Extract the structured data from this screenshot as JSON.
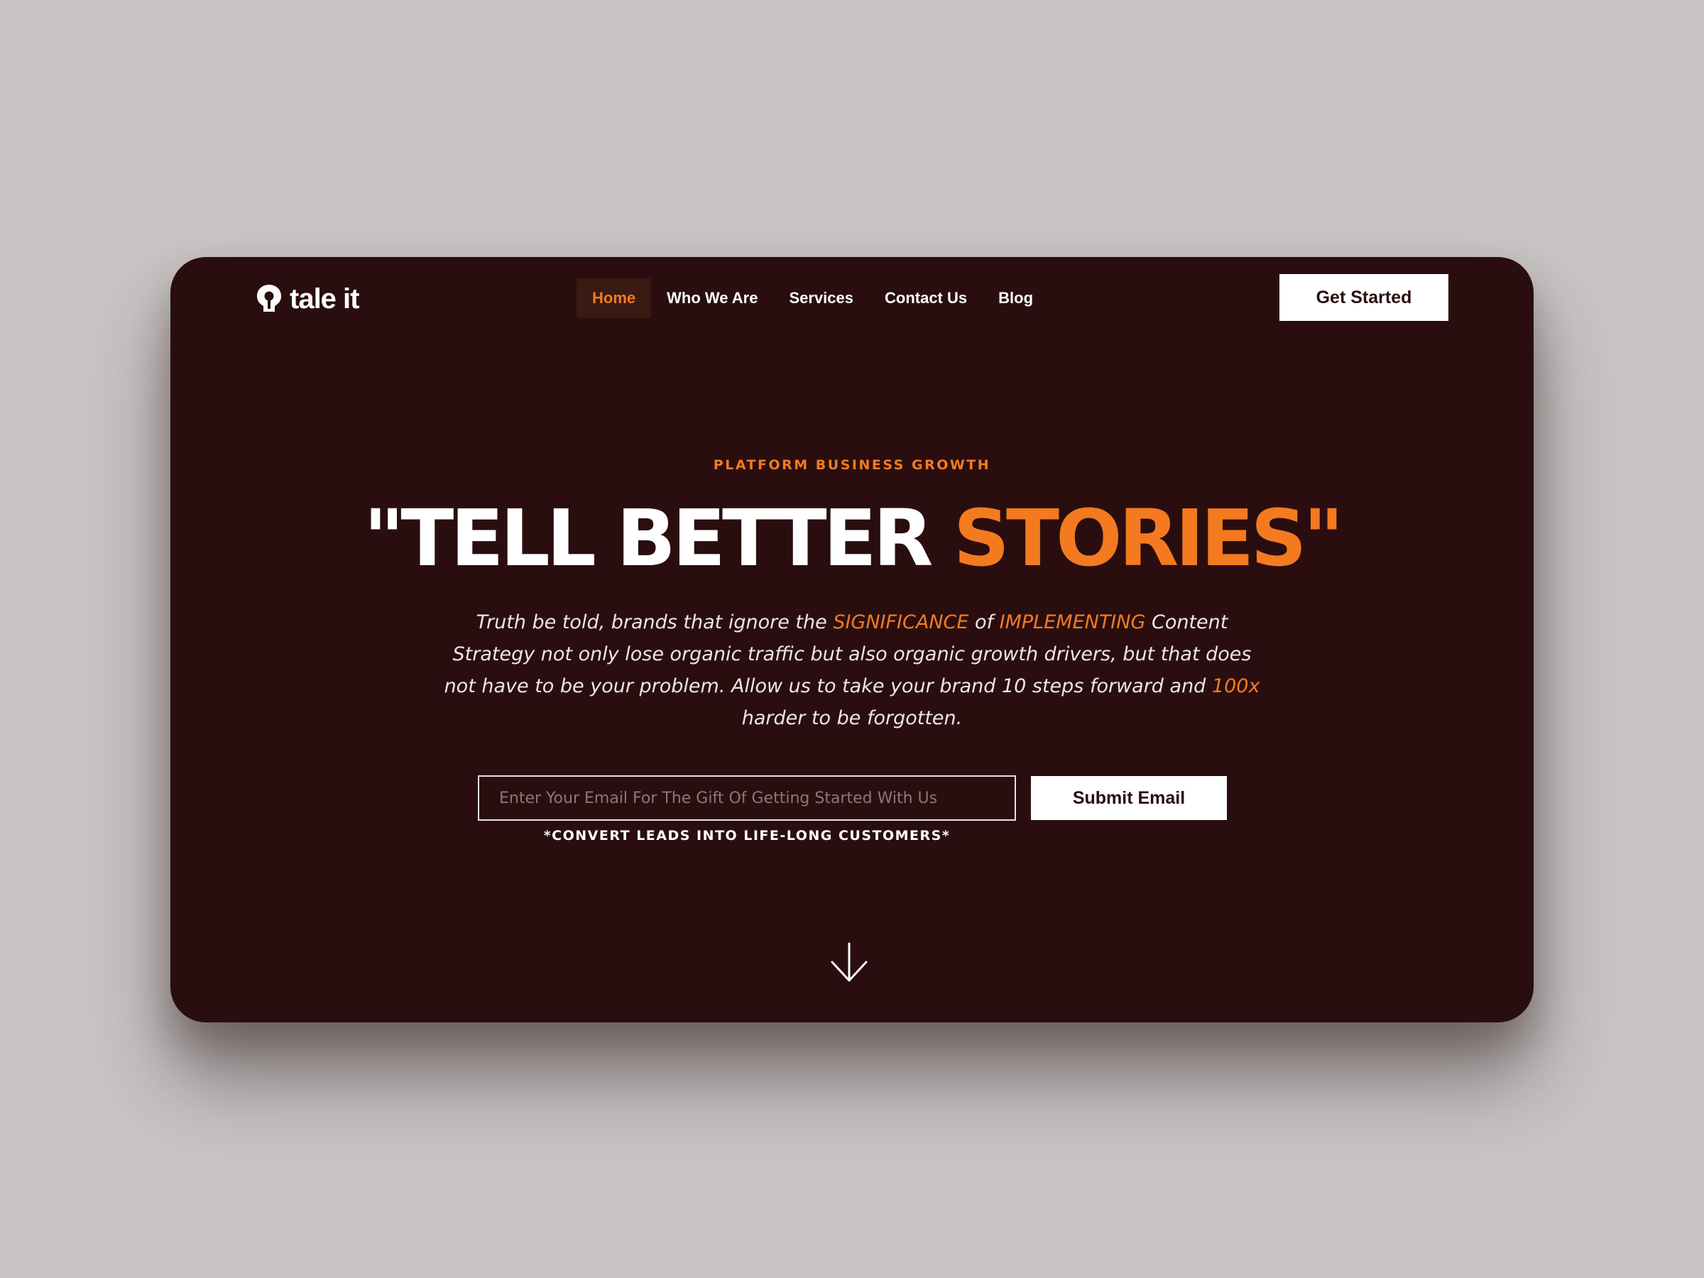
{
  "brand": {
    "name": "tale it",
    "logo_icon": "lightbulb-icon"
  },
  "nav": {
    "items": [
      {
        "label": "Home",
        "active": true
      },
      {
        "label": "Who We Are",
        "active": false
      },
      {
        "label": "Services",
        "active": false
      },
      {
        "label": "Contact Us",
        "active": false
      },
      {
        "label": "Blog",
        "active": false
      }
    ],
    "cta_label": "Get Started"
  },
  "hero": {
    "eyebrow": "PLATFORM BUSINESS GROWTH",
    "headline_white": "\"TELL BETTER ",
    "headline_accent": "STORIES\"",
    "body": {
      "p1": "Truth be told, brands that ignore the ",
      "hl1": "SIGNIFICANCE",
      "p2": " of ",
      "hl2": "IMPLEMENTING",
      "p3": " Content Strategy not only lose organic traffic but also organic growth drivers, but that does not have to be your problem. Allow us to take your brand 10 steps forward and ",
      "hl3": "100x",
      "p4": " harder to be forgotten."
    }
  },
  "form": {
    "email_placeholder": "Enter Your Email For The Gift Of Getting Started With Us",
    "email_value": "",
    "submit_label": "Submit Email",
    "note": "*CONVERT LEADS INTO LIFE-LONG CUSTOMERS*"
  },
  "scroll": {
    "icon": "arrow-down-icon"
  },
  "colors": {
    "background": "#c9c4c4",
    "card": "#2a0e0f",
    "accent": "#f47a20",
    "text": "#ffffff"
  }
}
